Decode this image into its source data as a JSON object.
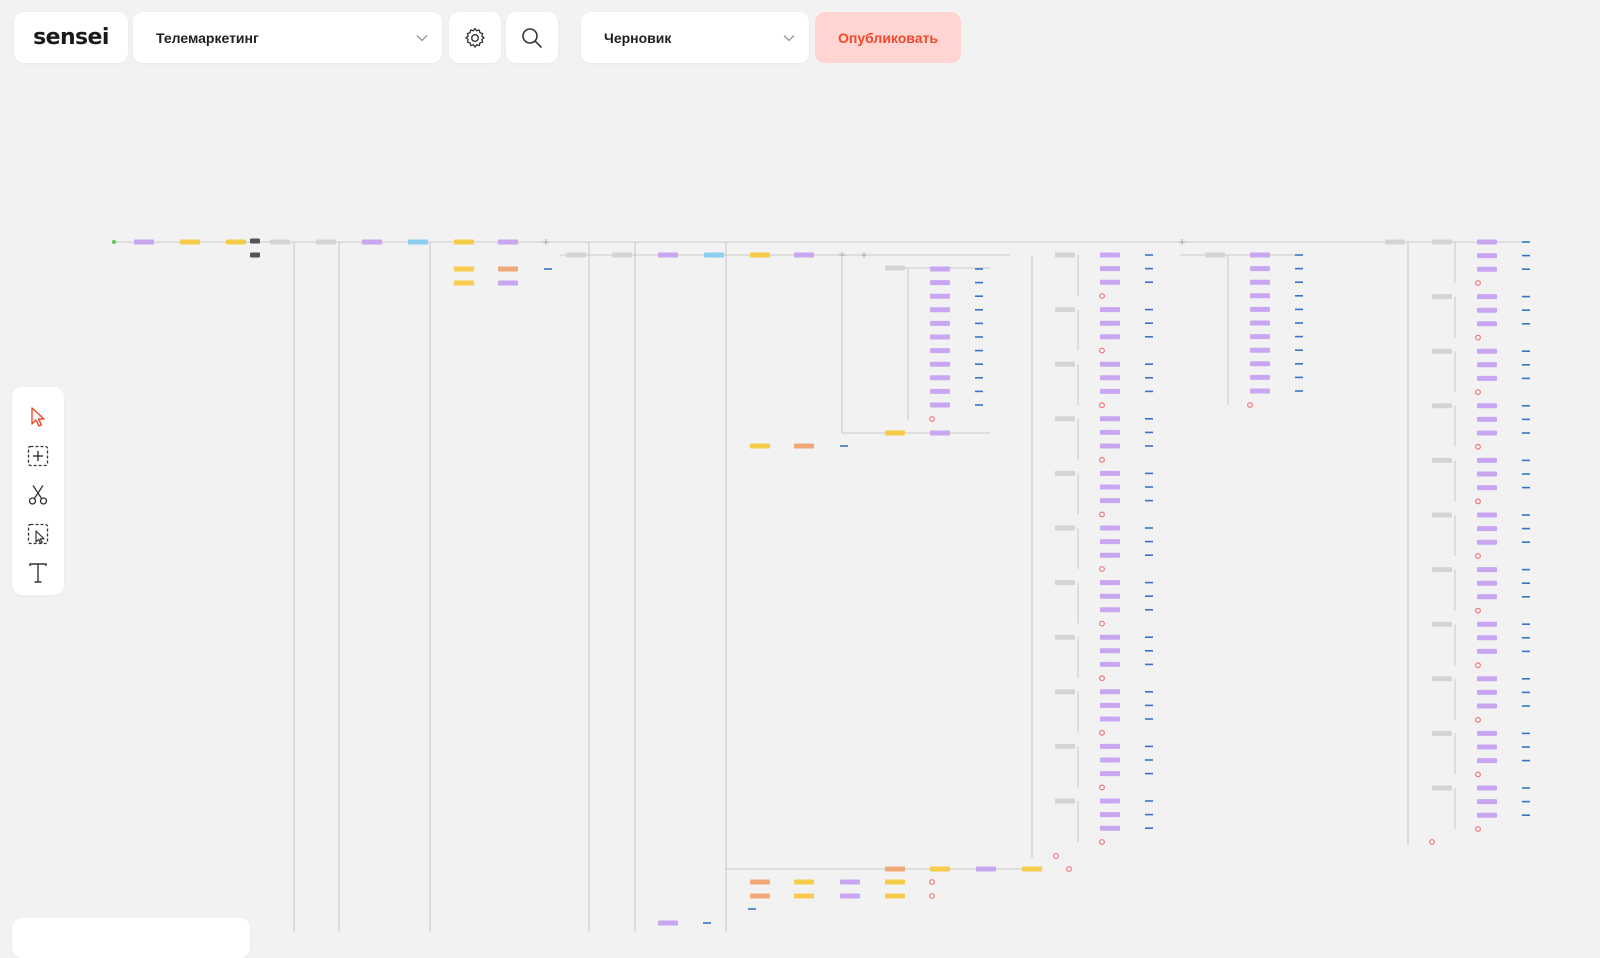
{
  "app": {
    "logo_text": "sensei"
  },
  "header": {
    "project_select": {
      "value": "Телемаркетинг",
      "icon": "chevron-down-icon"
    },
    "settings_icon": "gear-icon",
    "search_icon": "search-icon",
    "status_select": {
      "value": "Черновик",
      "icon": "chevron-down-icon"
    },
    "publish_label": "Опубликовать"
  },
  "toolbar": {
    "tools": [
      {
        "name": "select-tool",
        "icon": "cursor-arrow-icon",
        "active": true
      },
      {
        "name": "add-node-tool",
        "icon": "add-box-icon",
        "active": false
      },
      {
        "name": "cut-tool",
        "icon": "scissors-icon",
        "active": false
      },
      {
        "name": "area-select-tool",
        "icon": "area-select-icon",
        "active": false
      },
      {
        "name": "text-tool",
        "icon": "text-icon",
        "active": false
      }
    ]
  },
  "colors": {
    "accent": "#f04a2c",
    "publish_bg": "#ffd4d1",
    "node_purple": "#c9a6f2",
    "node_yellow": "#f7cc4a",
    "node_orange": "#f0a878",
    "node_blue": "#8ccdf0",
    "node_gray": "#d4d4d4",
    "link_blue": "#3a73c9",
    "end_red": "#f07070",
    "start_green": "#58c858",
    "edge": "#bdbdbd"
  }
}
